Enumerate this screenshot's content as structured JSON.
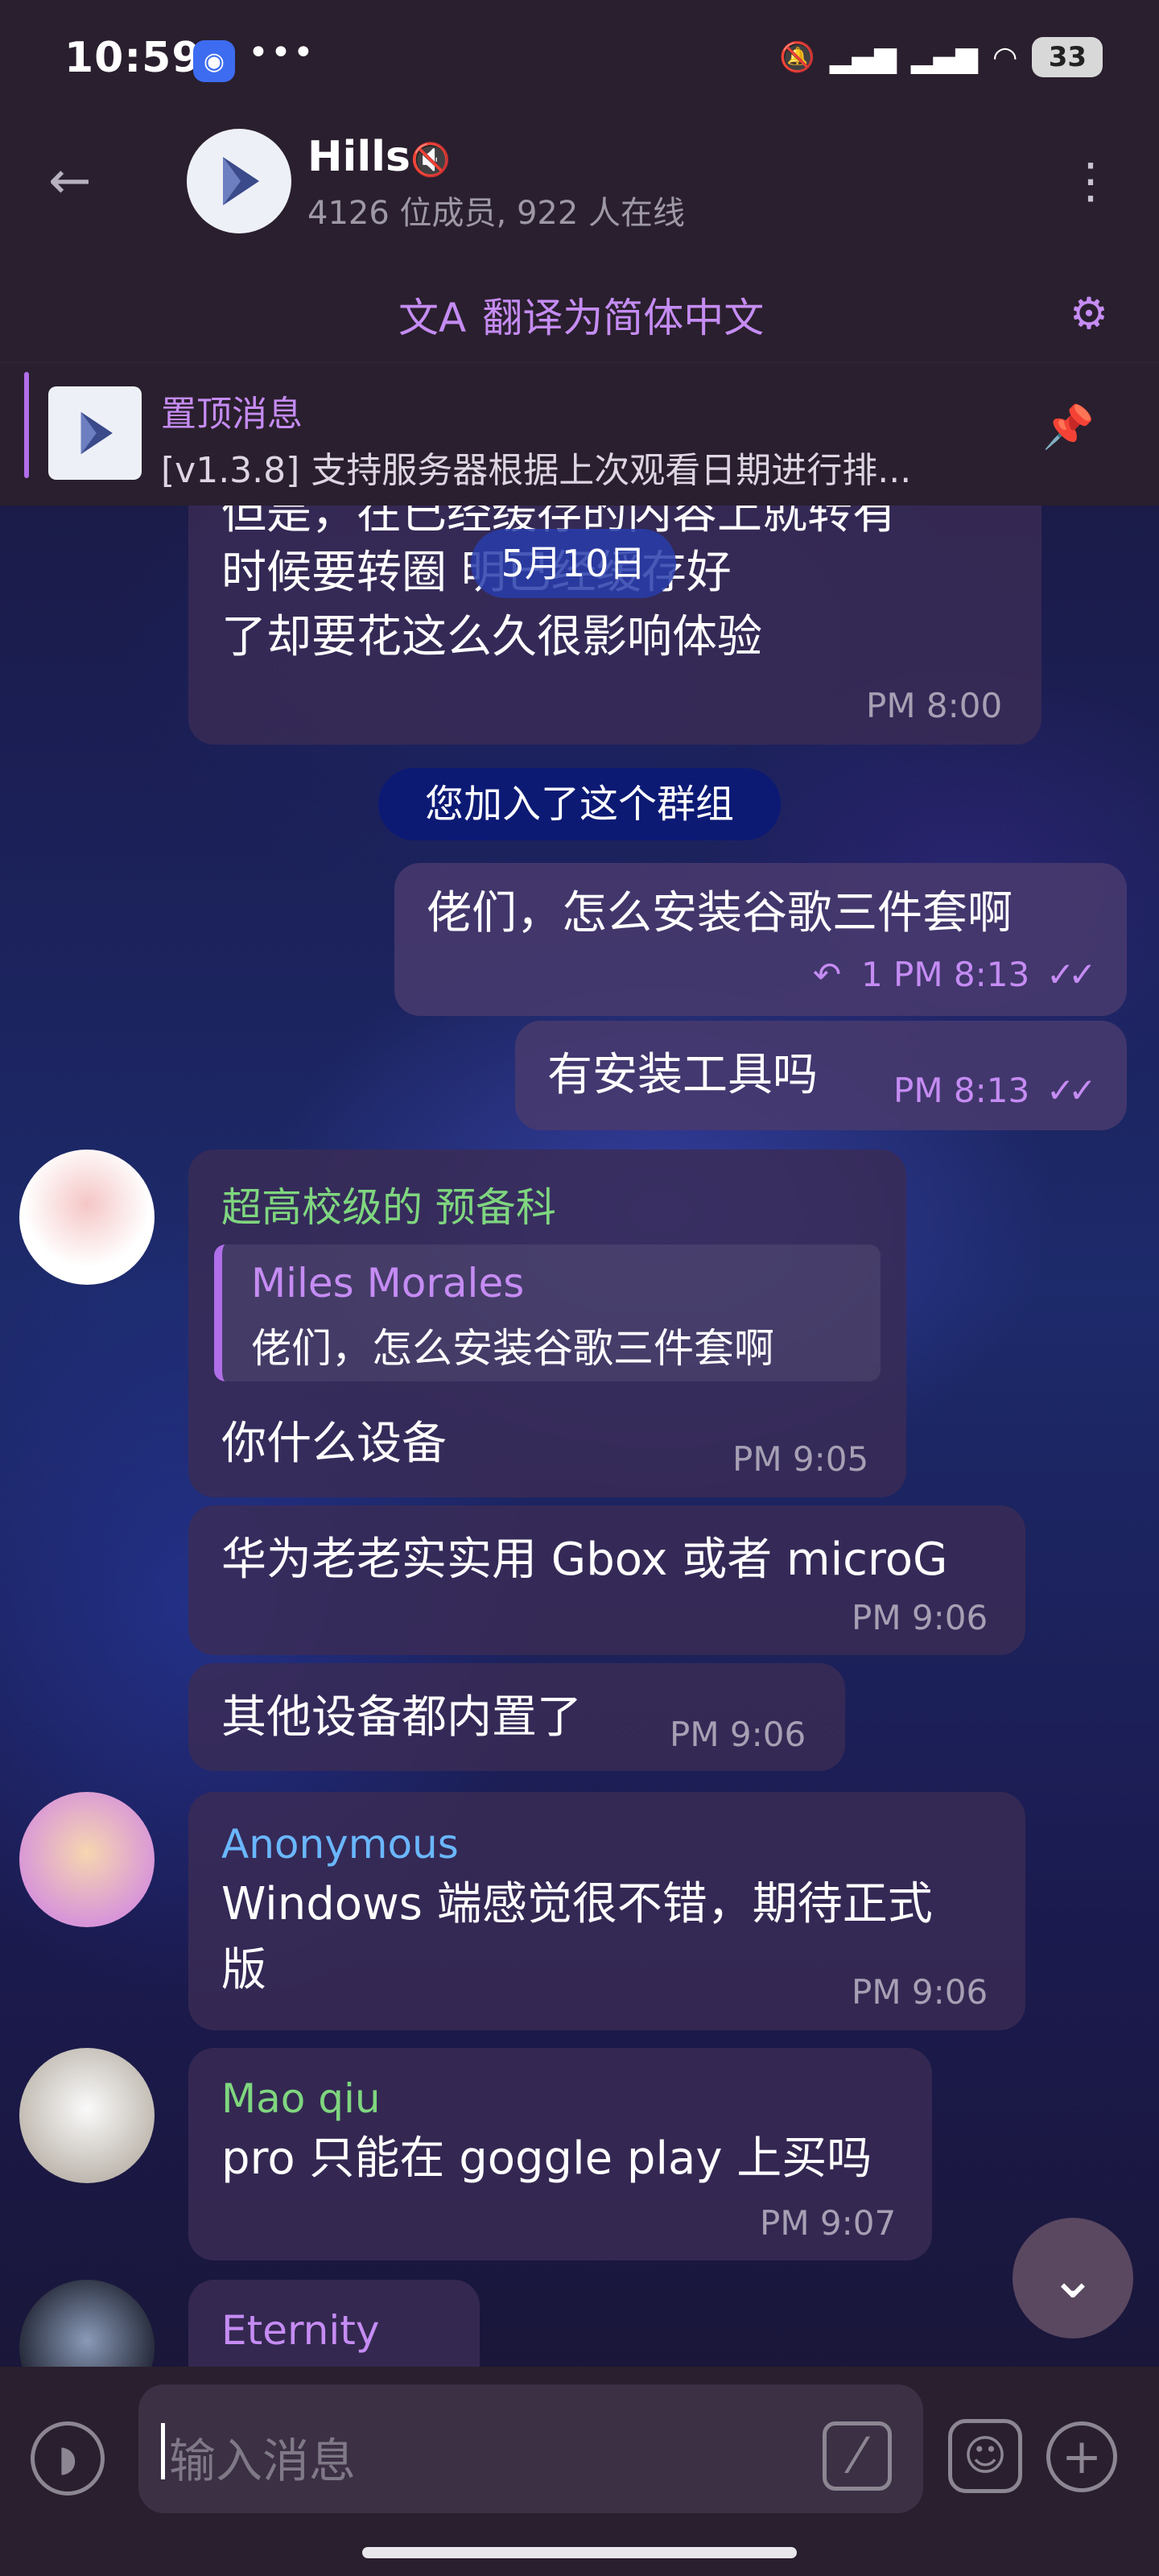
{
  "status_bar": {
    "time": "10:59",
    "dots": "•••",
    "battery": "33"
  },
  "header": {
    "title": "Hills",
    "subtitle": "4126 位成员, 922 人在线"
  },
  "translate": {
    "label": "翻译为简体中文"
  },
  "pinned": {
    "title": "置顶消息",
    "text": "[v1.3.8] 支持服务器根据上次观看日期进行排..."
  },
  "chat": {
    "partial_message": {
      "line1": "但是，在已经缓存的内容上就转有",
      "line2": "时候要转圈         明已经缓存好",
      "line3": "了却要花这么久很影响体验",
      "time": "PM 8:00"
    },
    "date_chip": "5月10日",
    "service_message": "您加入了这个群组",
    "outgoing": [
      {
        "text": "佬们，怎么安装谷歌三件套啊",
        "reply_count": "1",
        "time": "PM 8:13",
        "ticks": "✓✓"
      },
      {
        "text": "有安装工具吗",
        "time": "PM 8:13",
        "ticks": "✓✓"
      }
    ],
    "group1": {
      "sender": "超高校级的 预备科",
      "reply_name": "Miles Morales",
      "reply_text": "佬们，怎么安装谷歌三件套啊",
      "messages": [
        {
          "text": "你什么设备",
          "time": "PM 9:05"
        },
        {
          "text": "华为老老实实用 Gbox 或者 microG",
          "time": "PM 9:06"
        },
        {
          "text": "其他设备都内置了",
          "time": "PM 9:06"
        }
      ]
    },
    "group2": {
      "sender": "Anonymous",
      "line1": "Windows 端感觉很不错，期待正式",
      "line2": "版",
      "time": "PM 9:06"
    },
    "group3": {
      "sender": "Mao qiu",
      "text": "pro 只能在 goggle play 上买吗",
      "time": "PM 9:07"
    },
    "group4": {
      "sender": "Eternity"
    }
  },
  "input": {
    "placeholder": "输入消息"
  },
  "colors": {
    "accent": "#c58cf3",
    "sender1": "#7fd67f",
    "sender2": "#6ab7ff",
    "sender3": "#7fd67f",
    "sender4": "#c58cf3"
  }
}
